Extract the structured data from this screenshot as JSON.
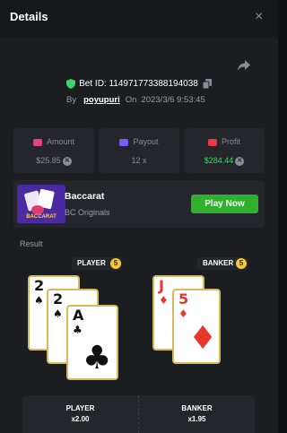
{
  "header": {
    "title": "Details",
    "close_glyph": "×"
  },
  "bet": {
    "id_text": "Bet ID: 114971773388194038",
    "by_label": "By",
    "user": "poyupuri",
    "on_label": "On",
    "datetime": "2023/3/6 9:53:45"
  },
  "stats": {
    "amount": {
      "label": "Amount",
      "value": "$25.85",
      "icon": "coins-icon",
      "color": "#e0447a"
    },
    "payout": {
      "label": "Payout",
      "value": "12 x",
      "icon": "payout-icon",
      "color": "#7a5af8"
    },
    "profit": {
      "label": "Profit",
      "value": "$284.44",
      "icon": "profit-icon",
      "color": "#e83a4a"
    }
  },
  "game": {
    "name": "Baccarat",
    "provider": "BC Originals",
    "thumb_text": "BACCARAT",
    "play_label": "Play Now"
  },
  "result": {
    "label": "Result",
    "player": {
      "label": "PLAYER",
      "score": "5",
      "cards": [
        {
          "rank": "2",
          "suit": "♠",
          "color": "black"
        },
        {
          "rank": "2",
          "suit": "♠",
          "color": "black"
        },
        {
          "rank": "A",
          "suit": "♣",
          "color": "black"
        }
      ]
    },
    "banker": {
      "label": "BANKER",
      "score": "5",
      "cards": [
        {
          "rank": "J",
          "suit": "♦",
          "color": "red"
        },
        {
          "rank": "5",
          "suit": "♦",
          "color": "red"
        }
      ]
    }
  },
  "bets": {
    "player": {
      "label": "PLAYER",
      "multiplier": "x2.00"
    },
    "banker": {
      "label": "BANKER",
      "multiplier": "x1.95"
    }
  },
  "colors": {
    "accent_green": "#2fb12f",
    "profit_green": "#3ed46a",
    "card_border": "#d7b85b",
    "score_yellow": "#f3c63c"
  }
}
